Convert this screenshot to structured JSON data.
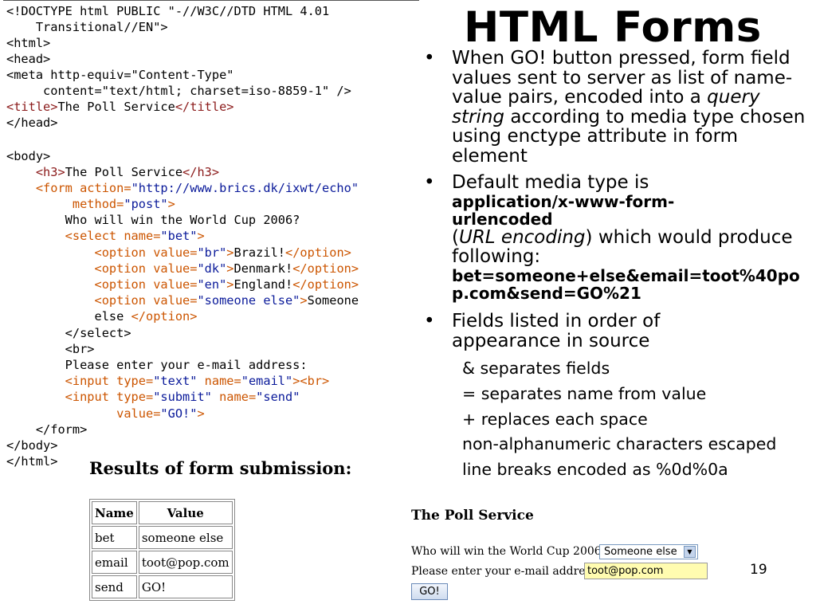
{
  "code": {
    "l1": "<!DOCTYPE html PUBLIC \"-//W3C//DTD HTML 4.01",
    "l2": "    Transitional//EN\">",
    "l3": "<html>",
    "l4": "<head>",
    "l5": "<meta http-equiv=\"Content-Type\"",
    "l6": "     content=\"text/html; charset=iso-8859-1\" />",
    "l7_tag_open": "<title>",
    "l7_text": "The Poll Service",
    "l7_tag_close": "</title>",
    "l8": "</head>",
    "l10": "<body>",
    "l11_tag_open": "    <h3>",
    "l11_text": "The Poll Service",
    "l11_tag_close": "</h3>",
    "l12_a": "    <form action=",
    "l12_b": "\"http://www.brics.dk/ixwt/echo\"",
    "l13_a": "         method=",
    "l13_b": "\"post\"",
    "l13_c": ">",
    "l14": "        Who will win the World Cup 2006?",
    "l15_a": "        <select name=",
    "l15_b": "\"bet\"",
    "l15_c": ">",
    "opt1_a": "            <option value=",
    "opt1_b": "\"br\"",
    "opt1_c": ">",
    "opt1_text": "Brazil!",
    "opt1_close": "</option>",
    "opt2_a": "            <option value=",
    "opt2_b": "\"dk\"",
    "opt2_c": ">",
    "opt2_text": "Denmark!",
    "opt2_close": "</option>",
    "opt3_a": "            <option value=",
    "opt3_b": "\"en\"",
    "opt3_c": ">",
    "opt3_text": "England!",
    "opt3_close": "</option>",
    "opt4_a": "            <option value=",
    "opt4_b": "\"someone else\"",
    "opt4_c": ">",
    "opt4_text": "Someone",
    "opt4_cont": "            else ",
    "opt4_close": "</option>",
    "l21": "        </select>",
    "l22": "        <br>",
    "l23": "        Please enter your e-mail address:",
    "in1_a": "        <input type=",
    "in1_b": "\"text\"",
    "in1_c": " name=",
    "in1_d": "\"email\"",
    "in1_e": "><br>",
    "in2_a": "        <input type=",
    "in2_b": "\"submit\"",
    "in2_c": " name=",
    "in2_d": "\"send\"",
    "in3_a": "               value=",
    "in3_b": "\"GO!\"",
    "in3_c": ">",
    "l27": "    </form>",
    "l28": "</body>",
    "l29": "</html>"
  },
  "slide": {
    "title": "HTML Forms",
    "bullet_char": "•",
    "b1": {
      "pre": "When GO! button pressed, form field values sent to server as list of name-value pairs, encoded into a ",
      "em": "query string",
      "post": " according to media type chosen using enctype attribute in form element"
    },
    "b2": {
      "pre": "Default media type is",
      "bold": "application/x-www-form-urlencoded",
      "paren_open": "(",
      "em": "URL encoding",
      "post": ") which would produce following:",
      "example": "bet=someone+else&email=toot%40pop.com&send=GO%21"
    },
    "b3": {
      "text": "Fields listed in order of appearance in source"
    },
    "sub": [
      "& separates fields",
      "= separates name from value",
      "+ replaces each space",
      "non-alphanumeric characters escaped",
      "line breaks encoded as %0d%0a"
    ],
    "page_number": "19"
  },
  "results": {
    "title": "Results of form submission:",
    "headers": [
      "Name",
      "Value"
    ],
    "rows": [
      [
        "bet",
        "someone else"
      ],
      [
        "email",
        "toot@pop.com"
      ],
      [
        "send",
        "GO!"
      ]
    ]
  },
  "poll": {
    "heading": "The Poll Service",
    "question": "Who will win the World Cup 2006?",
    "selected": "Someone else",
    "arrow": "▼",
    "email_label": "Please enter your e-mail address:",
    "email_value": "toot@pop.com",
    "submit_label": "GO!"
  }
}
